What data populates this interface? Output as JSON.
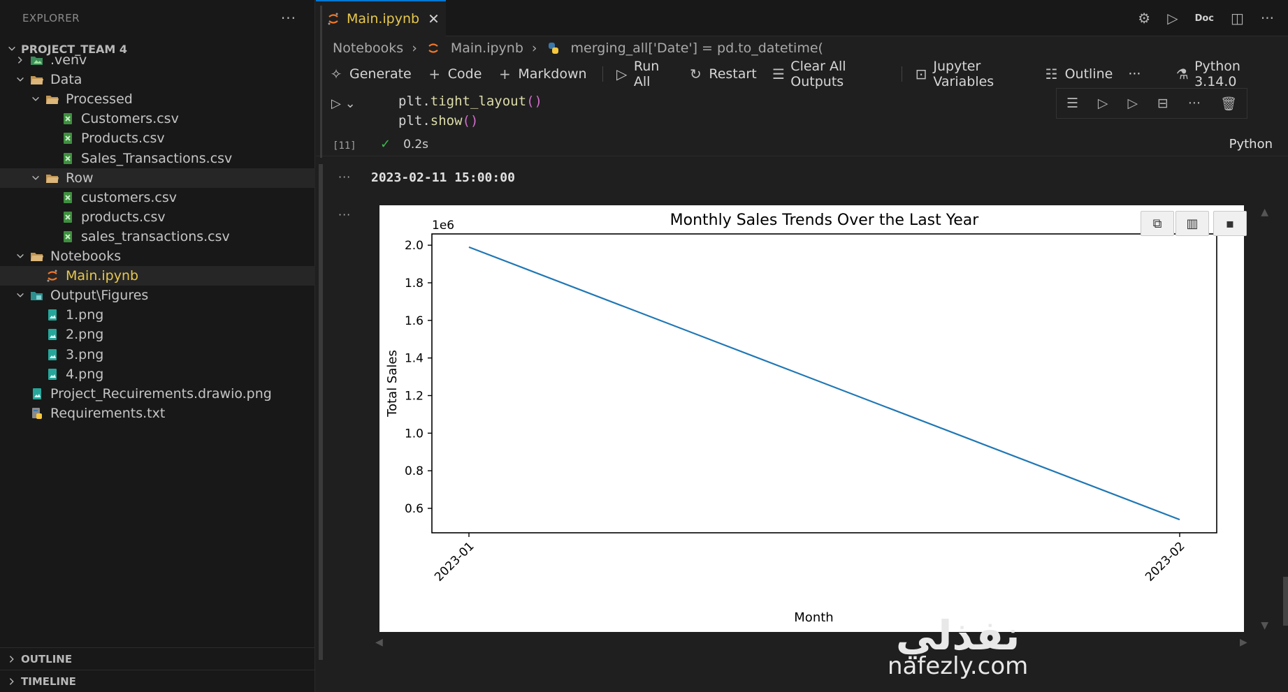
{
  "sidebar": {
    "title": "EXPLORER",
    "more": "···",
    "project": "PROJECT_TEAM 4",
    "tree": [
      {
        "label": ".venv",
        "icon": "venv-folder-icon",
        "depth": 1,
        "expanded": false,
        "kind": "folder"
      },
      {
        "label": "Data",
        "icon": "folder-open-icon",
        "depth": 1,
        "expanded": true,
        "kind": "folder"
      },
      {
        "label": "Processed",
        "icon": "folder-open-icon",
        "depth": 2,
        "expanded": true,
        "kind": "folder"
      },
      {
        "label": "Customers.csv",
        "icon": "csv-file-icon",
        "depth": 3,
        "kind": "file"
      },
      {
        "label": "Products.csv",
        "icon": "csv-file-icon",
        "depth": 3,
        "kind": "file"
      },
      {
        "label": "Sales_Transactions.csv",
        "icon": "csv-file-icon",
        "depth": 3,
        "kind": "file"
      },
      {
        "label": "Row",
        "icon": "folder-open-icon",
        "depth": 2,
        "expanded": true,
        "kind": "folder"
      },
      {
        "label": "customers.csv",
        "icon": "csv-file-icon",
        "depth": 3,
        "kind": "file"
      },
      {
        "label": "products.csv",
        "icon": "csv-file-icon",
        "depth": 3,
        "kind": "file"
      },
      {
        "label": "sales_transactions.csv",
        "icon": "csv-file-icon",
        "depth": 3,
        "kind": "file"
      },
      {
        "label": "Notebooks",
        "icon": "folder-open-icon",
        "depth": 1,
        "expanded": true,
        "kind": "folder"
      },
      {
        "label": "Main.ipynb",
        "icon": "jupyter-icon",
        "depth": 2,
        "kind": "file",
        "active": true
      },
      {
        "label": "Output\\Figures",
        "icon": "output-folder-icon",
        "depth": 1,
        "expanded": true,
        "kind": "folder"
      },
      {
        "label": "1.png",
        "icon": "image-file-icon",
        "depth": 2,
        "kind": "file"
      },
      {
        "label": "2.png",
        "icon": "image-file-icon",
        "depth": 2,
        "kind": "file"
      },
      {
        "label": "3.png",
        "icon": "image-file-icon",
        "depth": 2,
        "kind": "file"
      },
      {
        "label": "4.png",
        "icon": "image-file-icon",
        "depth": 2,
        "kind": "file"
      },
      {
        "label": "Project_Recuirements.drawio.png",
        "icon": "image-file-icon",
        "depth": 1,
        "kind": "file"
      },
      {
        "label": "Requirements.txt",
        "icon": "python-requirements-icon",
        "depth": 1,
        "kind": "file"
      }
    ],
    "outline": "OUTLINE",
    "timeline": "TIMELINE"
  },
  "tab": {
    "label": "Main.ipynb",
    "close": "✕"
  },
  "tab_actions": {
    "doc": "Doc"
  },
  "breadcrumb": [
    "Notebooks",
    "Main.ipynb",
    "merging_all['Date'] = pd.to_datetime("
  ],
  "toolbar": {
    "generate": "Generate",
    "code": "Code",
    "markdown": "Markdown",
    "run_all": "Run All",
    "restart": "Restart",
    "clear_outputs": "Clear All Outputs",
    "variables": "Jupyter Variables",
    "outline": "Outline",
    "more": "···",
    "kernel": "Python 3.14.0"
  },
  "cell": {
    "code": [
      {
        "obj": "plt",
        "fn": "tight_layout"
      },
      {
        "obj": "plt",
        "fn": "show"
      }
    ],
    "exec_count": "[11]",
    "duration": "0.2s",
    "language": "Python",
    "output_text": "2023-02-11 15:00:00"
  },
  "chart_data": {
    "type": "line",
    "title": "Monthly Sales Trends Over the Last Year",
    "xlabel": "Month",
    "ylabel": "Total Sales",
    "y_offset_label": "1e6",
    "categories": [
      "2023-01",
      "2023-02"
    ],
    "series": [
      {
        "values": [
          1990000,
          540000
        ]
      }
    ],
    "ylim": [
      0.47,
      2.06
    ],
    "yticks": [
      "0.6",
      "0.8",
      "1.0",
      "1.2",
      "1.4",
      "1.6",
      "1.8",
      "2.0"
    ],
    "line_color": "#1f77b4",
    "grid": false,
    "legend": "none"
  },
  "watermark": {
    "arabic": "نفذلي",
    "latin": "nafezly.com"
  }
}
